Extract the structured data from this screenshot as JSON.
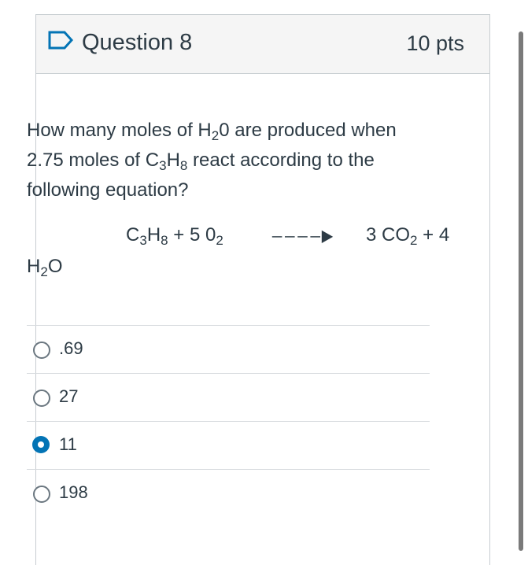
{
  "question": {
    "title": "Question 8",
    "points": "10 pts",
    "text_line1": "How many moles of H",
    "text_sub1": "2",
    "text_line1b": "0 are produced when",
    "text_line2a": "2.75 moles of C",
    "text_sub2a": "3",
    "text_line2b": "H",
    "text_sub2b": "8",
    "text_line2c": " react according to the",
    "text_line3": "following equation?"
  },
  "equation": {
    "left_c": "C",
    "left_c_sub": "3",
    "left_h": "H",
    "left_h_sub": "8",
    "left_rest": " + 5 0",
    "left_rest_sub": "2",
    "right_a": "3 CO",
    "right_a_sub": "2",
    "right_b": " + 4",
    "h2o_h": "H",
    "h2o_sub": "2",
    "h2o_o": "O"
  },
  "answers": [
    {
      "label": ".69",
      "selected": false
    },
    {
      "label": "27",
      "selected": false
    },
    {
      "label": "11",
      "selected": true
    },
    {
      "label": "198",
      "selected": false
    }
  ],
  "colors": {
    "selected_radio": "#0374b5",
    "header_bg": "#f5f5f5",
    "flag": "#0374b5"
  },
  "icons": {
    "flag": "bookmark-flag-icon",
    "arrow": "reaction-arrow-icon"
  }
}
